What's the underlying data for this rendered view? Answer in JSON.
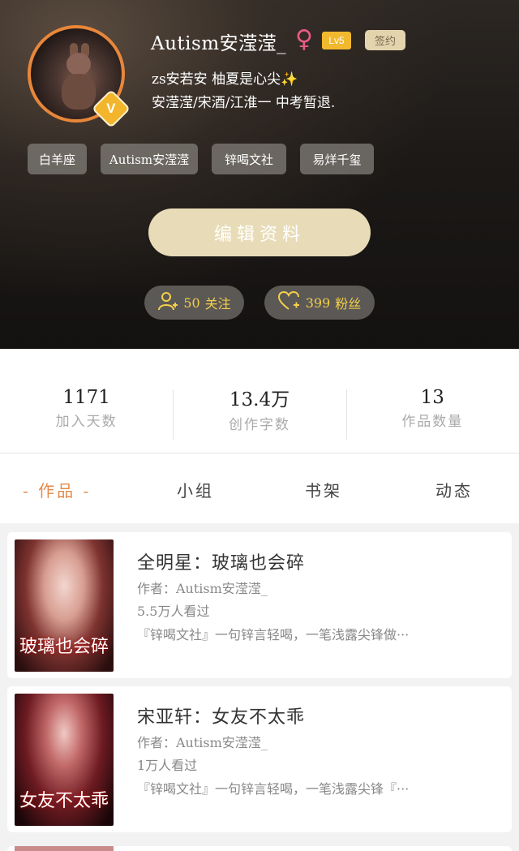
{
  "profile": {
    "username": "Autism安滢滢_",
    "gender_symbol": "♀",
    "level": "Lv5",
    "signed_label": "签约",
    "verify_mark": "V",
    "bio_line1": "zs安若安 柚夏是心尖",
    "bio_sparkle": "✨",
    "bio_line2": "安滢滢/宋酒/江淮一  中考暂退."
  },
  "tags": [
    "白羊座",
    "Autism安滢滢",
    "锌喝文社",
    "易烊千玺"
  ],
  "edit_button": "编辑资料",
  "follow": {
    "following_count": "50",
    "following_label": "关注",
    "fans_count": "399",
    "fans_label": "粉丝"
  },
  "stats": [
    {
      "value": "1171",
      "label": "加入天数"
    },
    {
      "value": "13.4万",
      "label": "创作字数"
    },
    {
      "value": "13",
      "label": "作品数量"
    }
  ],
  "tabs": [
    {
      "label": "- 作品 -",
      "active": true
    },
    {
      "label": "小组",
      "active": false
    },
    {
      "label": "书架",
      "active": false
    },
    {
      "label": "动态",
      "active": false
    }
  ],
  "works": [
    {
      "title": "全明星：玻璃也会碎",
      "author": "作者：Autism安滢滢_",
      "views": "5.5万人看过",
      "desc": "『锌喝文社』一句锌言轻喝，一笔浅露尖锋做···",
      "cover_text": "玻璃也会碎"
    },
    {
      "title": "宋亚轩：女友不太乖",
      "author": "作者：Autism安滢滢_",
      "views": "1万人看过",
      "desc": "『锌喝文社』一句锌言轻喝，一笔浅露尖锋『···",
      "cover_text": "女友不太乖"
    }
  ],
  "colors": {
    "accent_orange": "#e58a4c",
    "gold_text": "#f4cf4a",
    "edit_button_bg": "#e8dcb8",
    "level_badge": "#f2b92f"
  }
}
